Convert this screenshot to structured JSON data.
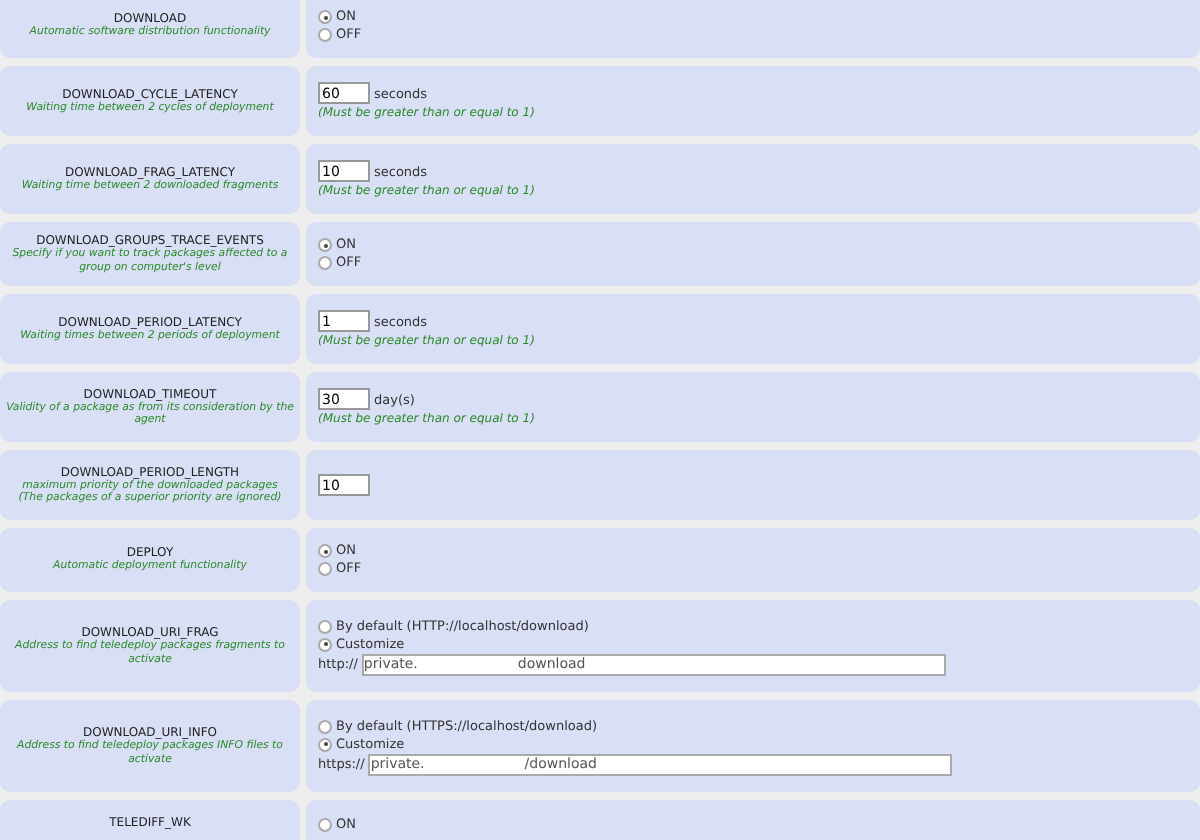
{
  "rows": [
    {
      "kind": "radio",
      "name": "DOWNLOAD",
      "description": "Automatic software distribution functionality",
      "options": [
        {
          "label": "ON",
          "selected": true
        },
        {
          "label": "OFF",
          "selected": false
        }
      ]
    },
    {
      "kind": "number",
      "name": "DOWNLOAD_CYCLE_LATENCY",
      "description": "Waiting time between 2 cycles of deployment",
      "value": "60",
      "unit": "seconds",
      "hint": "(Must be greater than or equal to 1)"
    },
    {
      "kind": "number",
      "name": "DOWNLOAD_FRAG_LATENCY",
      "description": "Waiting time between 2 downloaded fragments",
      "value": "10",
      "unit": "seconds",
      "hint": "(Must be greater than or equal to 1)"
    },
    {
      "kind": "radio",
      "name": "DOWNLOAD_GROUPS_TRACE_EVENTS",
      "description": "Specify if you want to track packages affected to a group on computer's level",
      "options": [
        {
          "label": "ON",
          "selected": true
        },
        {
          "label": "OFF",
          "selected": false
        }
      ]
    },
    {
      "kind": "number",
      "name": "DOWNLOAD_PERIOD_LATENCY",
      "description": "Waiting times between 2 periods of deployment",
      "value": "1",
      "unit": "seconds",
      "hint": "(Must be greater than or equal to 1)"
    },
    {
      "kind": "number",
      "name": "DOWNLOAD_TIMEOUT",
      "description": "Validity of a package as from its consideration by the agent",
      "value": "30",
      "unit": "day(s)",
      "hint": "(Must be greater than or equal to 1)"
    },
    {
      "kind": "number",
      "name": "DOWNLOAD_PERIOD_LENGTH",
      "description": "maximum priority of the downloaded packages\n(The packages of a superior priority are ignored)",
      "value": "10"
    },
    {
      "kind": "radio",
      "name": "DEPLOY",
      "description": "Automatic deployment functionality",
      "options": [
        {
          "label": "ON",
          "selected": true
        },
        {
          "label": "OFF",
          "selected": false
        }
      ]
    },
    {
      "kind": "uri",
      "name": "DOWNLOAD_URI_FRAG",
      "description": "Address to find teledeploy packages fragments to activate",
      "options": [
        {
          "label": "By default (HTTP://localhost/download)",
          "selected": false
        },
        {
          "label": "Customize",
          "selected": true
        }
      ],
      "scheme": "http://",
      "value_start": "private.",
      "value_end": "download"
    },
    {
      "kind": "uri",
      "name": "DOWNLOAD_URI_INFO",
      "description": "Address to find teledeploy packages INFO files to activate",
      "options": [
        {
          "label": "By default (HTTPS://localhost/download)",
          "selected": false
        },
        {
          "label": "Customize",
          "selected": true
        }
      ],
      "scheme": "https://",
      "value_start": "private.",
      "value_end": "/download"
    },
    {
      "kind": "radio",
      "name": "TELEDIFF_WK",
      "options": [
        {
          "label": "ON",
          "selected": false
        }
      ]
    }
  ]
}
